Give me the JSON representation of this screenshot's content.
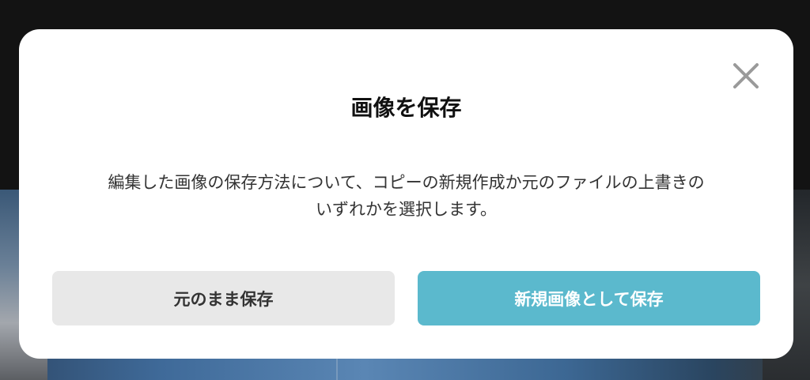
{
  "dialog": {
    "title": "画像を保存",
    "message_line1": "編集した画像の保存方法について、コピーの新規作成か元のファイルの上書きの",
    "message_line2": "いずれかを選択します。",
    "close_icon": "close-icon",
    "buttons": {
      "keep_original_label": "元のまま保存",
      "save_as_new_label": "新規画像として保存"
    }
  },
  "colors": {
    "primary_button": "#5bb9cd",
    "secondary_button": "#e8e8e8",
    "backdrop": "#131313"
  }
}
